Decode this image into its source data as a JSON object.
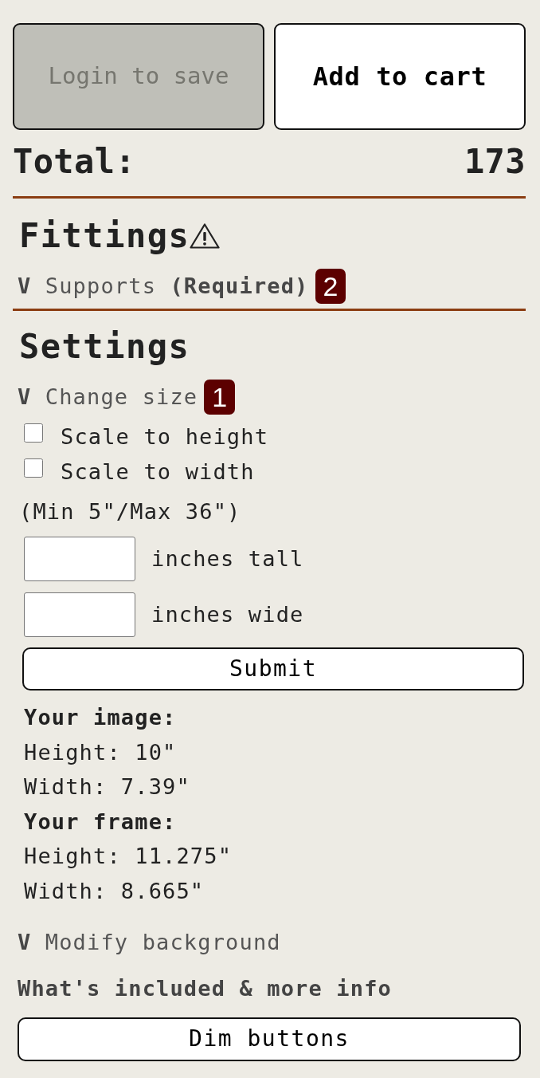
{
  "buttons": [
    {
      "label": "Login to save",
      "disabled": true
    },
    {
      "label": "Add to cart",
      "disabled": false
    }
  ],
  "total": {
    "label": "Total:",
    "value": "173"
  },
  "sections": [
    {
      "title": "Fittings",
      "warning": true,
      "items": [
        {
          "toggle": "V",
          "label": "Supports",
          "note": "(Required)",
          "badge": "2"
        }
      ]
    },
    {
      "title": "Settings",
      "warning": false,
      "items": [
        {
          "toggle": "V",
          "label": "Change size",
          "badge": "1",
          "options": [
            {
              "label": "Scale to height",
              "checked": false
            },
            {
              "label": "Scale to width",
              "checked": false
            }
          ],
          "range": "(Min 5\"/Max 36\")",
          "fields": [
            {
              "unit": "inches tall"
            },
            {
              "unit": "inches wide"
            }
          ],
          "submit": "Submit",
          "summary": [
            {
              "heading": "Your image:",
              "lines": [
                "Height: 10\"",
                "Width: 7.39\""
              ]
            },
            {
              "heading": "Your frame:",
              "lines": [
                "Height: 11.275\"",
                "Width: 8.665\""
              ]
            }
          ]
        },
        {
          "toggle": "V",
          "label": "Modify background"
        }
      ]
    }
  ],
  "info": "What's included & more info",
  "dim_button": "Dim buttons"
}
